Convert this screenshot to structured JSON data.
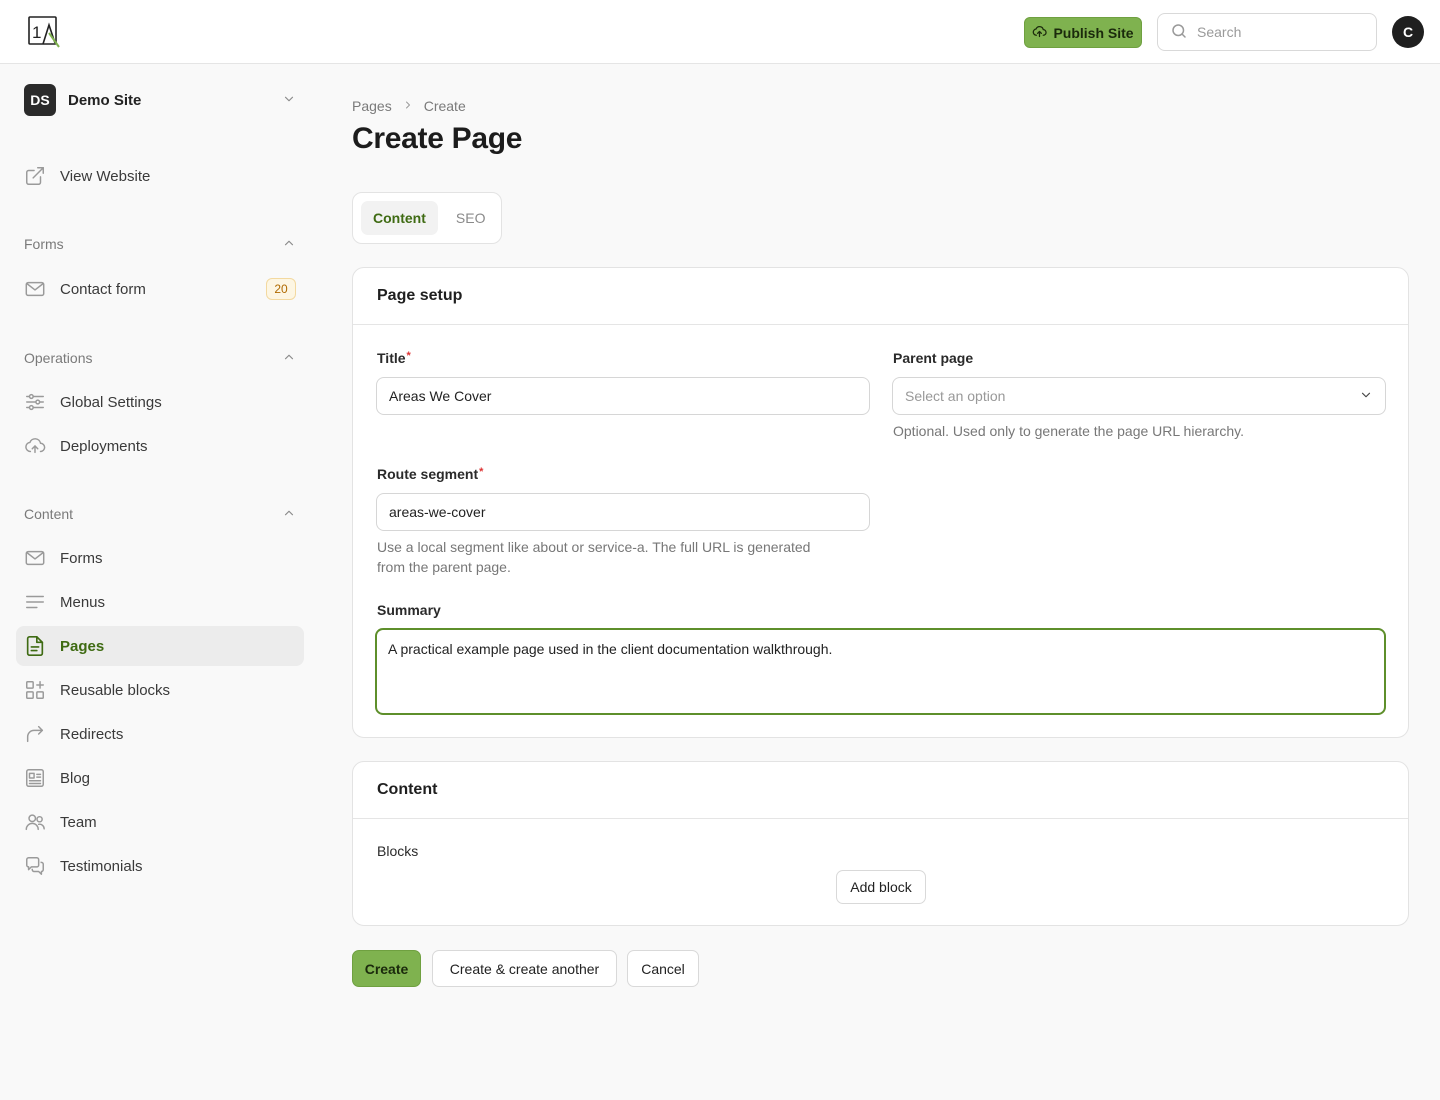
{
  "topbar": {
    "logo_text": "1A",
    "publish_label": "Publish Site",
    "search_placeholder": "Search",
    "avatar_initial": "C"
  },
  "sidebar": {
    "site": {
      "initials": "DS",
      "name": "Demo Site"
    },
    "view_website": "View Website",
    "groups": {
      "forms": {
        "label": "Forms",
        "items": [
          {
            "label": "Contact form",
            "badge": "20"
          }
        ]
      },
      "operations": {
        "label": "Operations",
        "items": [
          {
            "label": "Global Settings"
          },
          {
            "label": "Deployments"
          }
        ]
      },
      "content": {
        "label": "Content",
        "items": [
          {
            "label": "Forms"
          },
          {
            "label": "Menus"
          },
          {
            "label": "Pages"
          },
          {
            "label": "Reusable blocks"
          },
          {
            "label": "Redirects"
          },
          {
            "label": "Blog"
          },
          {
            "label": "Team"
          },
          {
            "label": "Testimonials"
          }
        ]
      }
    }
  },
  "main": {
    "breadcrumb": [
      "Pages",
      "Create"
    ],
    "title": "Create Page",
    "tabs": [
      "Content",
      "SEO"
    ],
    "page_setup": {
      "heading": "Page setup",
      "title_label": "Title",
      "title_value": "Areas We Cover",
      "parent_label": "Parent page",
      "parent_placeholder": "Select an option",
      "parent_hint": "Optional. Used only to generate the page URL hierarchy.",
      "route_label": "Route segment",
      "route_value": "areas-we-cover",
      "route_hint_line1": "Use a local segment like about or service-a. The full URL is generated",
      "route_hint_line2": "from the parent page.",
      "summary_label": "Summary",
      "summary_value": "A practical example page used in the client documentation walkthrough."
    },
    "content_section": {
      "heading": "Content",
      "blocks_label": "Blocks",
      "add_block": "Add block"
    },
    "actions": {
      "create": "Create",
      "create_another": "Create & create another",
      "cancel": "Cancel"
    }
  },
  "colors": {
    "accent": "#7fb24f",
    "active_text": "#3f6b13",
    "focus_border": "#5e8f2b"
  }
}
